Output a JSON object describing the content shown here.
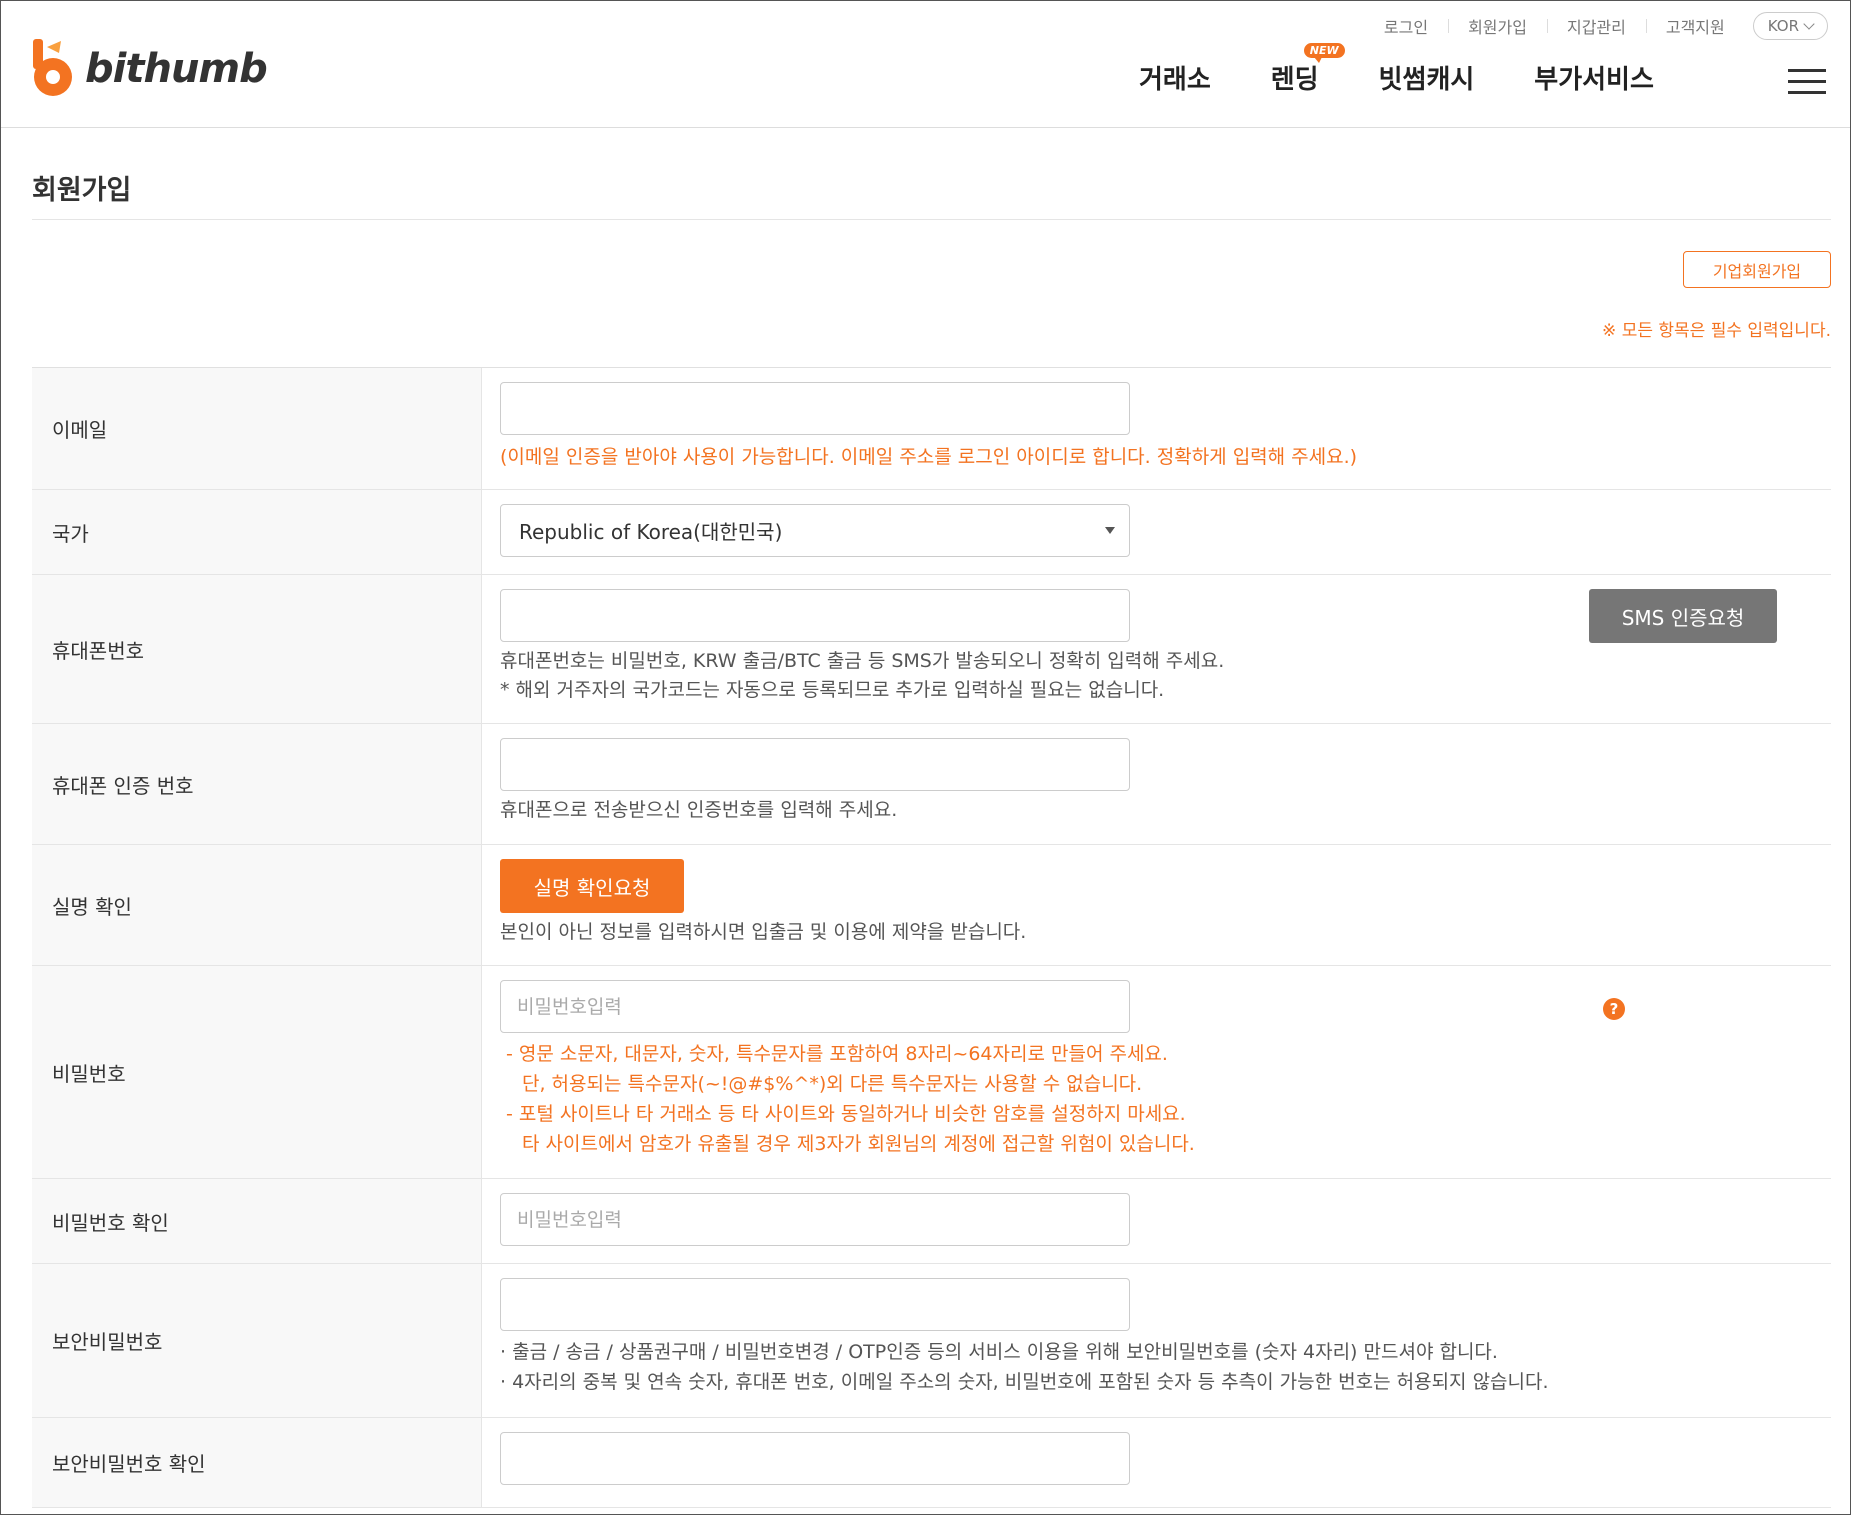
{
  "header": {
    "logo_text": "bithumb",
    "util_links": [
      "로그인",
      "회원가입",
      "지갑관리",
      "고객지원"
    ],
    "lang": "KOR",
    "nav": [
      {
        "label": "거래소",
        "badge": ""
      },
      {
        "label": "렌딩",
        "badge": "NEW"
      },
      {
        "label": "빗썸캐시",
        "badge": ""
      },
      {
        "label": "부가서비스",
        "badge": ""
      }
    ],
    "brand_color": "#f37321"
  },
  "page": {
    "title": "회원가입",
    "corp_button": "기업회원가입",
    "required_note": "※ 모든 항목은 필수 입력입니다."
  },
  "form": {
    "email": {
      "label": "이메일",
      "value": "",
      "help": "(이메일 인증을 받아야 사용이 가능합니다. 이메일 주소를 로그인 아이디로 합니다. 정확하게 입력해 주세요.)"
    },
    "country": {
      "label": "국가",
      "selected": "Republic of Korea(대한민국)"
    },
    "phone": {
      "label": "휴대폰번호",
      "value": "",
      "button": "SMS 인증요청",
      "help1": "휴대폰번호는 비밀번호, KRW 출금/BTC 출금 등 SMS가 발송되오니 정확히 입력해 주세요.",
      "help2": "* 해외 거주자의 국가코드는 자동으로 등록되므로 추가로 입력하실 필요는 없습니다."
    },
    "phone_code": {
      "label": "휴대폰 인증 번호",
      "value": "",
      "help": "휴대폰으로 전송받으신 인증번호를 입력해 주세요."
    },
    "realname": {
      "label": "실명 확인",
      "button": "실명 확인요청",
      "help": "본인이 아닌 정보를 입력하시면 입출금 및 이용에 제약을 받습니다."
    },
    "password": {
      "label": "비밀번호",
      "placeholder": "비밀번호입력",
      "help_icon": "?",
      "rule1": "- 영문 소문자, 대문자, 숫자, 특수문자를 포함하여 8자리~64자리로 만들어 주세요.",
      "rule1b": "단, 허용되는 특수문자(~!@#$%^*)외 다른 특수문자는 사용할 수 없습니다.",
      "rule2": "- 포털 사이트나 타 거래소 등 타 사이트와 동일하거나 비슷한 암호를 설정하지 마세요.",
      "rule2b": "타 사이트에서 암호가 유출될 경우 제3자가 회원님의 계정에 접근할 위험이 있습니다."
    },
    "password_confirm": {
      "label": "비밀번호 확인",
      "placeholder": "비밀번호입력"
    },
    "security_pw": {
      "label": "보안비밀번호",
      "value": "",
      "note1": "출금 / 송금 / 상품권구매 / 비밀번호변경 / OTP인증 등의 서비스 이용을 위해 보안비밀번호를 (숫자 4자리) 만드셔야 합니다.",
      "note2": "4자리의 중복 및 연속 숫자, 휴대폰 번호, 이메일 주소의 숫자, 비밀번호에 포함된 숫자 등 추측이 가능한 번호는 허용되지 않습니다."
    },
    "security_pw_confirm": {
      "label": "보안비밀번호 확인",
      "value": ""
    }
  }
}
